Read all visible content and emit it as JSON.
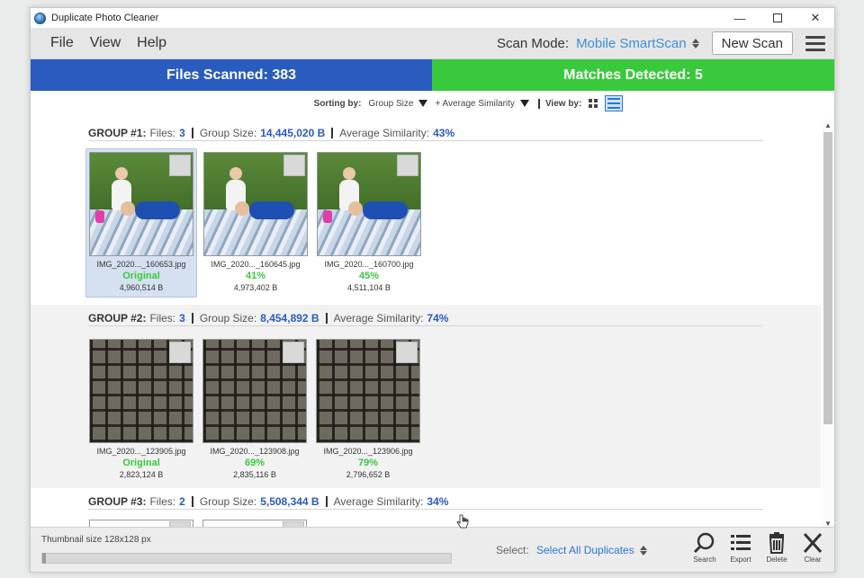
{
  "window": {
    "title": "Duplicate Photo Cleaner"
  },
  "menu": {
    "items": [
      "File",
      "View",
      "Help"
    ]
  },
  "scan": {
    "label": "Scan Mode:",
    "mode": "Mobile SmartScan",
    "new_scan_label": "New Scan"
  },
  "stats": {
    "files_scanned": "Files Scanned: 383",
    "matches_detected": "Matches Detected: 5",
    "files_color": "#2a5bbf",
    "matches_color": "#38c93c"
  },
  "sorting": {
    "label": "Sorting by:",
    "primary": "Group Size",
    "secondary": "+ Average Similarity",
    "view_label": "View by:"
  },
  "group_labels": {
    "files": "Files:",
    "size": "Group Size:",
    "similarity": "Average Similarity:"
  },
  "groups": [
    {
      "title": "GROUP #1:",
      "files": "3",
      "size": "14,445,020 B",
      "similarity": "43%",
      "images": [
        {
          "name": "IMG_2020..._160653.jpg",
          "tag": "Original",
          "size": "4,960,514 B",
          "selected": true
        },
        {
          "name": "IMG_2020..._160645.jpg",
          "tag": "41%",
          "size": "4,973,402 B"
        },
        {
          "name": "IMG_2020..._160700.jpg",
          "tag": "45%",
          "size": "4,511,104 B"
        }
      ]
    },
    {
      "title": "GROUP #2:",
      "files": "3",
      "size": "8,454,892 B",
      "similarity": "74%",
      "images": [
        {
          "name": "IMG_2020..._123905.jpg",
          "tag": "Original",
          "size": "2,823,124 B"
        },
        {
          "name": "IMG_2020..._123908.jpg",
          "tag": "69%",
          "size": "2,835,116 B"
        },
        {
          "name": "IMG_2020..._123906.jpg",
          "tag": "79%",
          "size": "2,796,652 B"
        }
      ]
    },
    {
      "title": "GROUP #3:",
      "files": "2",
      "size": "5,508,344 B",
      "similarity": "34%"
    }
  ],
  "bottom": {
    "thumbnail_size": "Thumbnail size 128x128 px",
    "select_label": "Select:",
    "select_value": "Select All Duplicates",
    "tools": [
      "Search",
      "Export",
      "Delete",
      "Clear"
    ]
  }
}
